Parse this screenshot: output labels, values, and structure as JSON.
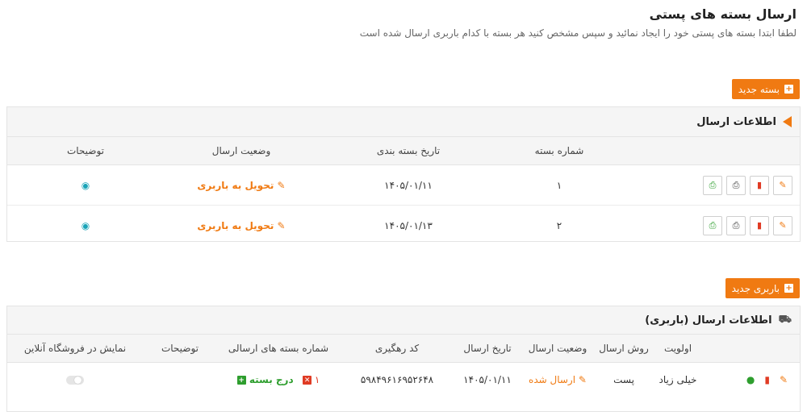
{
  "page": {
    "title": "ارسال بسته های پستی",
    "subtitle": "لطفا ابتدا بسته های پستی خود را ایجاد نمائید و سپس مشخص کنید هر بسته با کدام باربری ارسال شده است"
  },
  "packages": {
    "new_button": "بسته جدید",
    "panel_title": "اطلاعات ارسال",
    "columns": [
      "شماره بسته",
      "تاریخ بسته بندی",
      "وضعیت ارسال",
      "توضیحات"
    ],
    "rows": [
      {
        "number": "۱",
        "date": "۱۴۰۵/۰۱/۱۱",
        "status": "تحویل به باربری"
      },
      {
        "number": "۲",
        "date": "۱۴۰۵/۰۱/۱۳",
        "status": "تحویل به باربری"
      }
    ]
  },
  "shipments": {
    "new_button": "باربری جدید",
    "panel_title": "اطلاعات ارسال (باربری)",
    "columns": [
      "اولویت",
      "روش ارسال",
      "وضعیت ارسال",
      "تاریخ ارسال",
      "کد رهگیری",
      "شماره بسته های ارسالی",
      "توضیحات",
      "نمایش در فروشگاه آنلاین"
    ],
    "rows": [
      {
        "priority": "خیلی زیاد",
        "method": "پست",
        "status": "ارسال شده",
        "date": "۱۴۰۵/۰۱/۱۱",
        "tracking": "۵۹۸۴۹۶۱۶۹۵۲۶۴۸",
        "package_no": "۱",
        "add_package": "درج بسته",
        "notes": "",
        "show_online": false
      }
    ]
  },
  "colors": {
    "accent": "#f07a12",
    "danger": "#e03b24",
    "success": "#2e9e2e",
    "info": "#1aa4b8"
  },
  "icons": {
    "edit": "pencil-icon",
    "delete": "trash-icon",
    "print": "printer-icon",
    "view": "eye-icon",
    "chat": "chat-icon",
    "truck": "truck-icon"
  }
}
